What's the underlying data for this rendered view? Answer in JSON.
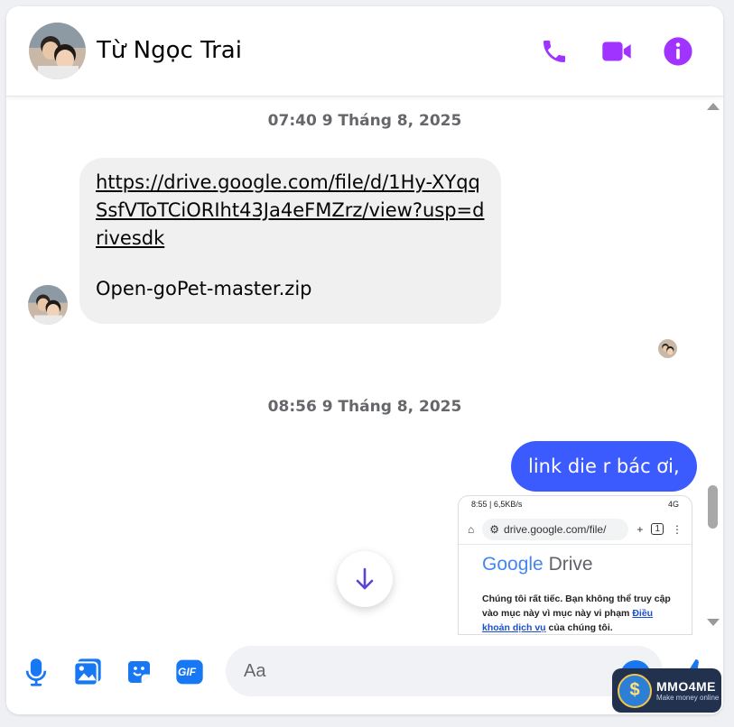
{
  "header": {
    "contact_name": "Từ Ngọc Trai",
    "call_icon": "phone-icon",
    "video_icon": "video-camera-icon",
    "info_icon": "info-icon"
  },
  "thread": {
    "timestamps": [
      "07:40 9 Tháng 8, 2025",
      "08:56 9 Tháng 8, 2025"
    ],
    "incoming_message": {
      "link": "https://drive.google.com/file/d/1Hy-XYqqSsfVToTCiORIht43Ja4eFMZrz/view?usp=drivesdk",
      "filename": "Open-goPet-master.zip"
    },
    "outgoing_message": "link die r bác ơi,",
    "screenshot": {
      "time": "8:55 | 6,5KB/s",
      "status_right": "4G",
      "url": "drive.google.com/file/",
      "tab_count": "1",
      "logo_word": "Google",
      "logo_product": "Drive",
      "error_text": "Chúng tôi rất tiếc. Bạn không thể truy cập vào mục này vì mục này vi phạm ",
      "error_link": "Điều khoản dịch vụ",
      "error_tail": " của chúng tôi."
    }
  },
  "composer": {
    "placeholder": "Aa",
    "icons": [
      "microphone-icon",
      "photo-icon",
      "sticker-icon",
      "gif-icon",
      "emoji-icon",
      "thumbs-up-icon"
    ],
    "gif_label": "GIF"
  },
  "watermark": {
    "brand": "MMO4ME",
    "tagline": "Make money online",
    "coin_symbol": "$"
  },
  "colors": {
    "accent_purple": "#a033ff",
    "accent_blue": "#1877f2",
    "outgoing_bubble": "#3b5bff",
    "scroll_arrow": "#5b45d6"
  }
}
